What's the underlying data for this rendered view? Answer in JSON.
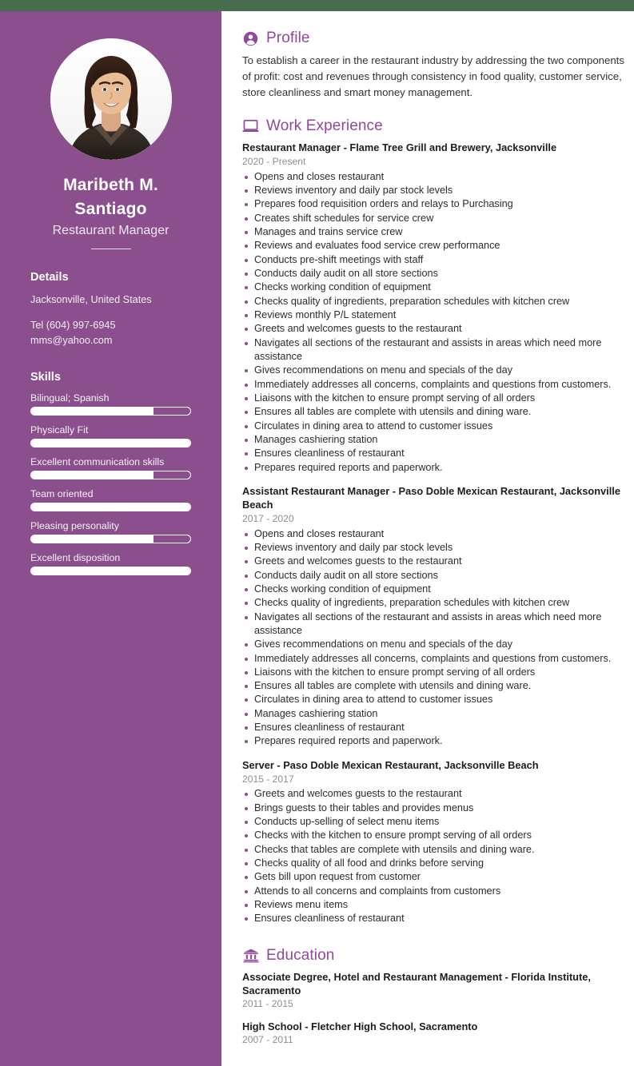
{
  "theme": {
    "top_strip_color": "#466e4c",
    "sidebar_color": "#8a4f8c",
    "accent_color": "#91489a",
    "bullet_color": "#8a4f8c",
    "text_color": "#2c2c2c",
    "muted_color": "#8e8e8e"
  },
  "sidebar": {
    "avatar_alt": "portrait-photo",
    "name": "Maribeth M. Santiago",
    "role": "Restaurant Manager",
    "details": {
      "heading": "Details",
      "location": "Jacksonville, United States",
      "phone": "Tel (604) 997-6945",
      "email": "mms@yahoo.com"
    },
    "skills": {
      "heading": "Skills",
      "items": [
        {
          "label": "Bilingual; Spanish",
          "level": 77
        },
        {
          "label": "Physically Fit",
          "level": 100
        },
        {
          "label": "Excellent communication skills",
          "level": 77
        },
        {
          "label": "Team oriented",
          "level": 100
        },
        {
          "label": "Pleasing personality",
          "level": 77
        },
        {
          "label": "Excellent disposition",
          "level": 100
        }
      ]
    }
  },
  "main": {
    "profile": {
      "icon": "person-circle-icon",
      "title": "Profile",
      "text": "To establish a career in the restaurant industry by addressing the two components of profit: cost and revenues through consistency in food quality, customer service, store cleanliness and smart money management."
    },
    "work": {
      "icon": "laptop-icon",
      "title": "Work Experience",
      "entries": [
        {
          "title": "Restaurant Manager - Flame Tree Grill and Brewery, Jacksonville",
          "date": "2020 - Present",
          "bullets": [
            "Opens and closes restaurant",
            "Reviews inventory and daily par stock levels",
            "Prepares food requisition orders and relays to Purchasing",
            "Creates shift schedules for service crew",
            "Manages and trains service crew",
            "Reviews and evaluates food service crew performance",
            "Conducts pre-shift meetings with staff",
            "Conducts daily audit on all store sections",
            "Checks working condition of equipment",
            "Checks quality of ingredients, preparation schedules with kitchen crew",
            "Reviews monthly P/L statement",
            "Greets and welcomes guests to the restaurant",
            "Navigates all sections of the restaurant and assists in areas which need more assistance",
            "Gives recommendations on menu and specials of the day",
            "Immediately addresses all concerns, complaints and questions from customers.",
            "Liaisons with the kitchen to ensure prompt serving of all orders",
            "Ensures all tables are complete with utensils and dining ware.",
            "Circulates in dining area to attend to customer issues",
            "Manages cashiering station",
            "Ensures cleanliness of restaurant",
            "Prepares required reports and paperwork."
          ]
        },
        {
          "title": "Assistant Restaurant Manager - Paso Doble Mexican Restaurant, Jacksonville Beach",
          "date": "2017 - 2020",
          "bullets": [
            "Opens and closes restaurant",
            "Reviews inventory and daily par stock levels",
            "Greets and welcomes guests to the restaurant",
            "Conducts daily audit on all store sections",
            "Checks working condition of equipment",
            "Checks quality of ingredients, preparation schedules with kitchen crew",
            "Navigates all sections of the restaurant and assists in areas which need more assistance",
            "Gives recommendations on menu and specials of the day",
            "Immediately addresses all concerns, complaints and questions from customers.",
            "Liaisons with the kitchen to ensure prompt serving of all orders",
            "Ensures all tables are complete with utensils and dining ware.",
            "Circulates in dining area to attend to customer issues",
            "Manages cashiering station",
            "Ensures cleanliness of restaurant",
            "Prepares required reports and paperwork."
          ]
        },
        {
          "title": "Server - Paso Doble Mexican Restaurant, Jacksonville Beach",
          "date": "2015 - 2017",
          "bullets": [
            "Greets and welcomes guests to the restaurant",
            "Brings guests to their tables and provides menus",
            "Conducts up-selling of select menu items",
            "Checks with the kitchen to ensure prompt serving of all orders",
            "Checks that tables are complete with utensils and dining ware.",
            "Checks quality of all food and drinks before serving",
            "Gets bill upon request from customer",
            "Attends to all concerns and complaints from customers",
            "Reviews menu items",
            "Ensures cleanliness of restaurant"
          ]
        }
      ]
    },
    "education": {
      "icon": "bank-building-icon",
      "title": "Education",
      "entries": [
        {
          "title": "Associate Degree, Hotel and Restaurant Management - Florida Institute, Sacramento",
          "date": "2011 - 2015"
        },
        {
          "title": "High School - Fletcher High School, Sacramento",
          "date": "2007 - 2011"
        }
      ]
    }
  }
}
